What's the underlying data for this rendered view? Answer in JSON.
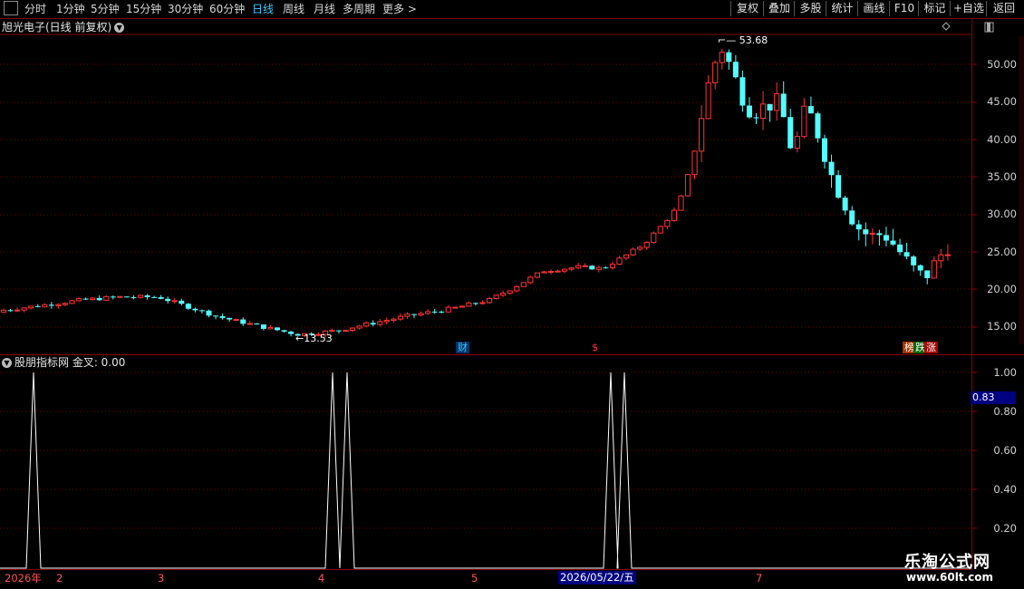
{
  "toolbar": {
    "periods": [
      "分时",
      "1分钟",
      "5分钟",
      "15分钟",
      "30分钟",
      "60分钟",
      "日线",
      "周线",
      "月线",
      "多周期",
      "更多 >"
    ],
    "active_period": "日线",
    "actions": [
      "复权",
      "叠加",
      "多股",
      "统计",
      "画线",
      "F10",
      "标记",
      "+自选",
      "返回"
    ]
  },
  "main_chart": {
    "title": "旭光电子(日线 前复权)",
    "high_label": "53.68",
    "low_label": "13.53",
    "price_axis": [
      "50.00",
      "45.00",
      "40.00",
      "35.00",
      "30.00",
      "25.00",
      "20.00",
      "15.00"
    ],
    "markers": [
      {
        "text": "财",
        "color": "#33ccff"
      },
      {
        "text": "$",
        "color": "#ff3333"
      },
      {
        "text": "榜",
        "color": "#ffffff"
      },
      {
        "text": "跌",
        "color": "#ffffff"
      },
      {
        "text": "涨",
        "color": "#ffffff"
      }
    ]
  },
  "indicator": {
    "title": "股朋指标网 金叉: 0.00",
    "axis": [
      "1.00",
      "0.80",
      "0.60",
      "0.40",
      "0.20"
    ],
    "current_value": "0.83"
  },
  "date_axis": {
    "labels": [
      "2026年",
      "2",
      "3",
      "4",
      "5",
      "7"
    ],
    "highlight": "2026/05/22/五"
  },
  "watermark": {
    "name": "乐淘公式网",
    "url": "www.60lt.com"
  },
  "colors": {
    "up": "#ff3333",
    "down": "#54ffff",
    "grid": "#8b0000"
  }
}
